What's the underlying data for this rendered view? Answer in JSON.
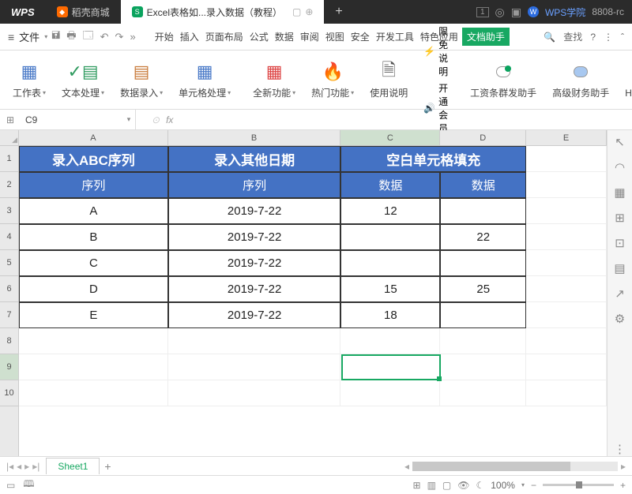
{
  "titlebar": {
    "logo": "WPS",
    "tabs": [
      {
        "label": "稻壳商城",
        "icon_color": "orange"
      },
      {
        "label": "Excel表格如...录入数据（教程）",
        "icon_color": "green",
        "active": true
      }
    ],
    "right": {
      "wps_academy": "WPS学院",
      "user": "8808-rc",
      "box": "1"
    }
  },
  "menubar": {
    "file": "文件",
    "items": [
      "开始",
      "插入",
      "页面布局",
      "公式",
      "数据",
      "审阅",
      "视图",
      "安全",
      "开发工具",
      "特色应用",
      "文档助手"
    ],
    "search": "查找"
  },
  "ribbon": {
    "groups": [
      {
        "label": "工作表"
      },
      {
        "label": "文本处理"
      },
      {
        "label": "数据录入"
      },
      {
        "label": "单元格处理"
      },
      {
        "label": "全新功能"
      },
      {
        "label": "热门功能"
      },
      {
        "label": "使用说明"
      }
    ],
    "text_items": {
      "exempt": "限免说明",
      "open_member": "开通会员"
    },
    "assist": [
      {
        "label": "工资条群发助手"
      },
      {
        "label": "高级财务助手"
      },
      {
        "label": "HR助手"
      }
    ]
  },
  "fbar": {
    "namebox": "C9",
    "fx": "fx"
  },
  "grid": {
    "selectall_icon": "◢",
    "cols": [
      "A",
      "B",
      "C",
      "D",
      "E"
    ],
    "rows": [
      "1",
      "2",
      "3",
      "4",
      "5",
      "6",
      "7",
      "8",
      "9",
      "10"
    ],
    "headers": {
      "ab_merged": "录入ABC序列",
      "cd_merged": "空白单元格填充",
      "b_title": "录入其他日期",
      "a2": "序列",
      "b2": "序列",
      "c2": "数据",
      "d2": "数据"
    },
    "data": [
      {
        "a": "A",
        "b": "2019-7-22",
        "c": "12",
        "d": ""
      },
      {
        "a": "B",
        "b": "2019-7-22",
        "c": "",
        "d": "22"
      },
      {
        "a": "C",
        "b": "2019-7-22",
        "c": "",
        "d": ""
      },
      {
        "a": "D",
        "b": "2019-7-22",
        "c": "15",
        "d": "25"
      },
      {
        "a": "E",
        "b": "2019-7-22",
        "c": "18",
        "d": ""
      }
    ]
  },
  "sheetbar": {
    "sheet": "Sheet1"
  },
  "statusbar": {
    "zoom": "100%"
  }
}
